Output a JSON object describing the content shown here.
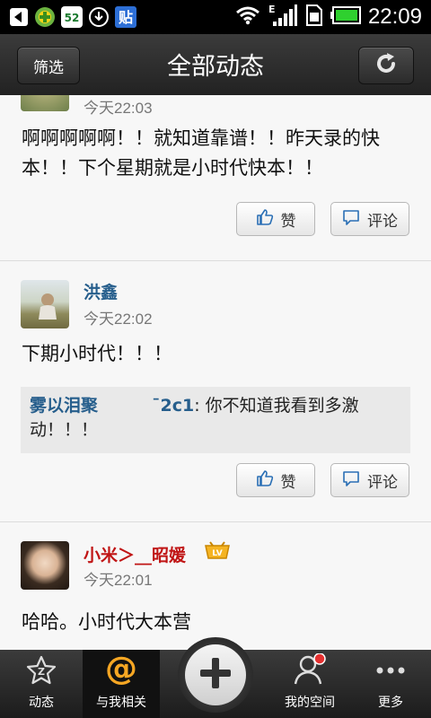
{
  "status_bar": {
    "time": "22:09"
  },
  "header": {
    "filter_label": "筛选",
    "title": "全部动态"
  },
  "posts": [
    {
      "time": "今天22:03",
      "text": "啊啊啊啊啊！！就知道靠谱！！昨天录的快本！！下个星期就是小时代快本！！",
      "like_label": "赞",
      "comment_label": "评论"
    },
    {
      "name": "洪鑫",
      "time": "今天22:02",
      "text": "下期小时代！！！",
      "quote_name": "雾以泪聚",
      "quote_name2": "ˉ2c1",
      "quote_text": ": 你不知道我看到多激动！！！",
      "like_label": "赞",
      "comment_label": "评论"
    },
    {
      "name": "小米＞__昭媛",
      "time": "今天22:01",
      "text": "哈哈。小时代大本营"
    }
  ],
  "tabbar": {
    "tabs": [
      {
        "label": "动态"
      },
      {
        "label": "与我相关"
      },
      {
        "label": "我的空间"
      },
      {
        "label": "更多"
      }
    ]
  },
  "colors": {
    "username": "#265e8c",
    "vip_name": "#c01515",
    "accent": "#f5a623"
  }
}
